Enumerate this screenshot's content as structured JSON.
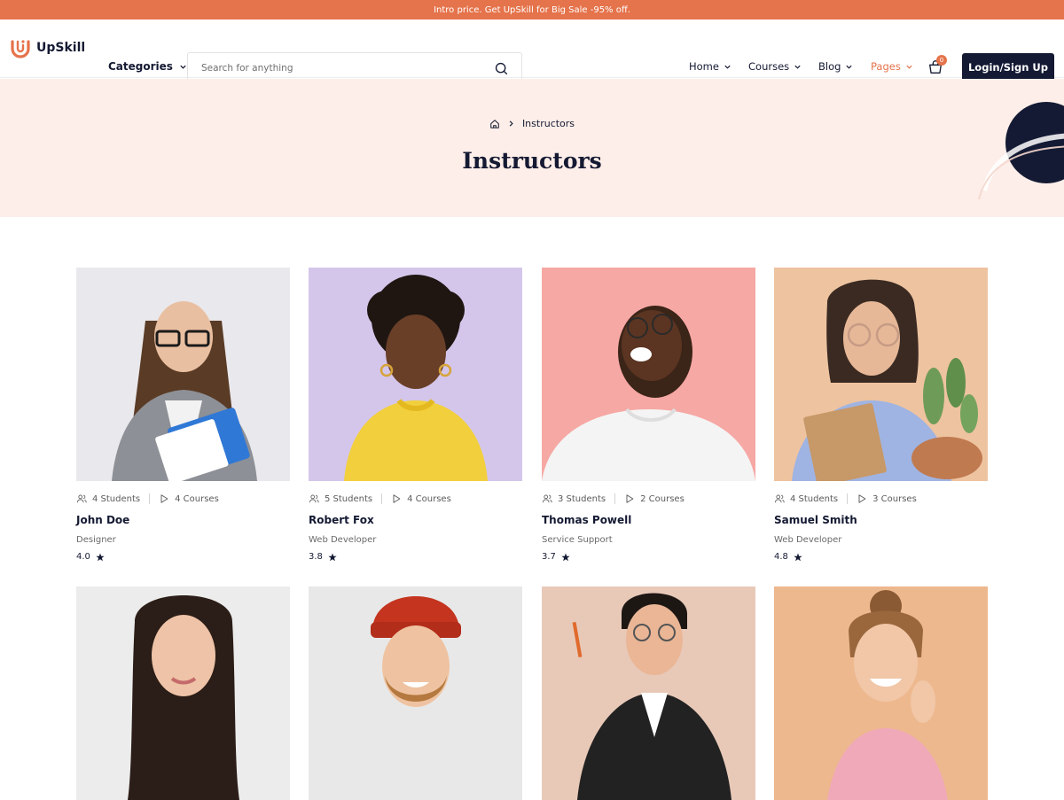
{
  "promo": {
    "text": "Intro price. Get UpSkill for Big Sale -95% off."
  },
  "brand": {
    "name": "UpSkill",
    "accent": "#e5734b",
    "dark": "#141a33"
  },
  "header": {
    "categories_label": "Categories",
    "search_placeholder": "Search for anything",
    "nav": [
      {
        "label": "Home"
      },
      {
        "label": "Courses"
      },
      {
        "label": "Blog"
      },
      {
        "label": "Pages",
        "active": true
      }
    ],
    "cart_count": "0",
    "login_label": "Login/Sign Up"
  },
  "hero": {
    "breadcrumb_current": "Instructors",
    "title": "Instructors"
  },
  "instructors": [
    {
      "students": "4 Students",
      "courses": "4 Courses",
      "name": "John Doe",
      "role": "Designer",
      "rating": "4.0",
      "bg": "#e9e8ec"
    },
    {
      "students": "5 Students",
      "courses": "4 Courses",
      "name": "Robert Fox",
      "role": "Web Developer",
      "rating": "3.8",
      "bg": "#d4c6ea"
    },
    {
      "students": "3 Students",
      "courses": "2 Courses",
      "name": "Thomas Powell",
      "role": "Service Support",
      "rating": "3.7",
      "bg": "#f6a8a4"
    },
    {
      "students": "4 Students",
      "courses": "3 Courses",
      "name": "Samuel Smith",
      "role": "Web Developer",
      "rating": "4.8",
      "bg": "#eec3a0"
    },
    {
      "bg": "#ececec"
    },
    {
      "bg": "#e8e8e8"
    },
    {
      "bg": "#e8c9b8"
    },
    {
      "bg": "#eeb88e"
    }
  ]
}
